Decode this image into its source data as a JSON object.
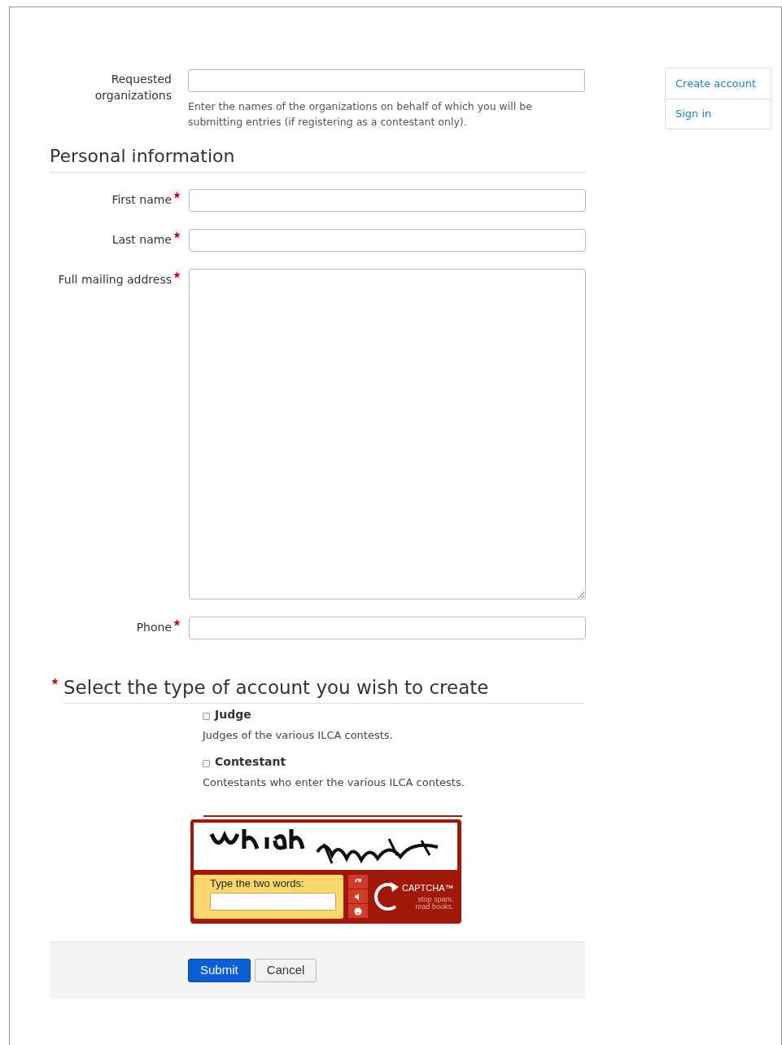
{
  "organizations": {
    "label": "Requested organizations",
    "help": "Enter the names of the organizations on behalf of which you will be submitting entries (if registering as a contestant only)."
  },
  "sidebar": [
    {
      "label": "Create account"
    },
    {
      "label": "Sign in"
    }
  ],
  "personal": {
    "heading": "Personal information",
    "fields": [
      {
        "label": "First name",
        "required": true,
        "kind": "text"
      },
      {
        "label": "Last name",
        "required": true,
        "kind": "text"
      },
      {
        "label": "Full mailing address",
        "required": true,
        "kind": "textarea"
      },
      {
        "label": "Phone",
        "required": true,
        "kind": "text"
      }
    ]
  },
  "account_type": {
    "heading": "Select the type of account you wish to create",
    "required": true,
    "options": [
      {
        "label": "Judge",
        "description": "Judges of the various ILCA contests.",
        "checked": false
      },
      {
        "label": "Contestant",
        "description": "Contestants who enter the various ILCA contests.",
        "checked": false
      }
    ]
  },
  "captcha": {
    "prompt": "Type the two words:",
    "logo": "CAPTCHA™",
    "tagline_1": "stop spam.",
    "tagline_2": "read books."
  },
  "buttons": [
    {
      "label": "Submit",
      "kind": "primary"
    },
    {
      "label": "Cancel",
      "kind": "secondary"
    }
  ]
}
